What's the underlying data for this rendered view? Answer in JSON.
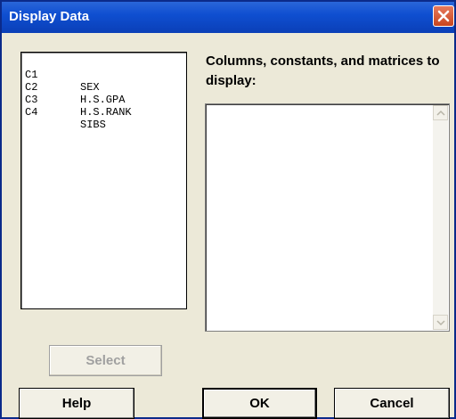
{
  "window": {
    "title": "Display Data"
  },
  "variables": [
    {
      "id": "C1",
      "name": "SEX"
    },
    {
      "id": "C2",
      "name": "H.S.GPA"
    },
    {
      "id": "C3",
      "name": "H.S.RANK"
    },
    {
      "id": "C4",
      "name": "SIBS"
    }
  ],
  "display": {
    "label": "Columns, constants, and matrices to display:",
    "value": ""
  },
  "buttons": {
    "select": "Select",
    "help": "Help",
    "ok": "OK",
    "cancel": "Cancel"
  },
  "icons": {
    "close": "close-icon",
    "scroll_up": "chevron-up-icon",
    "scroll_down": "chevron-down-icon"
  }
}
